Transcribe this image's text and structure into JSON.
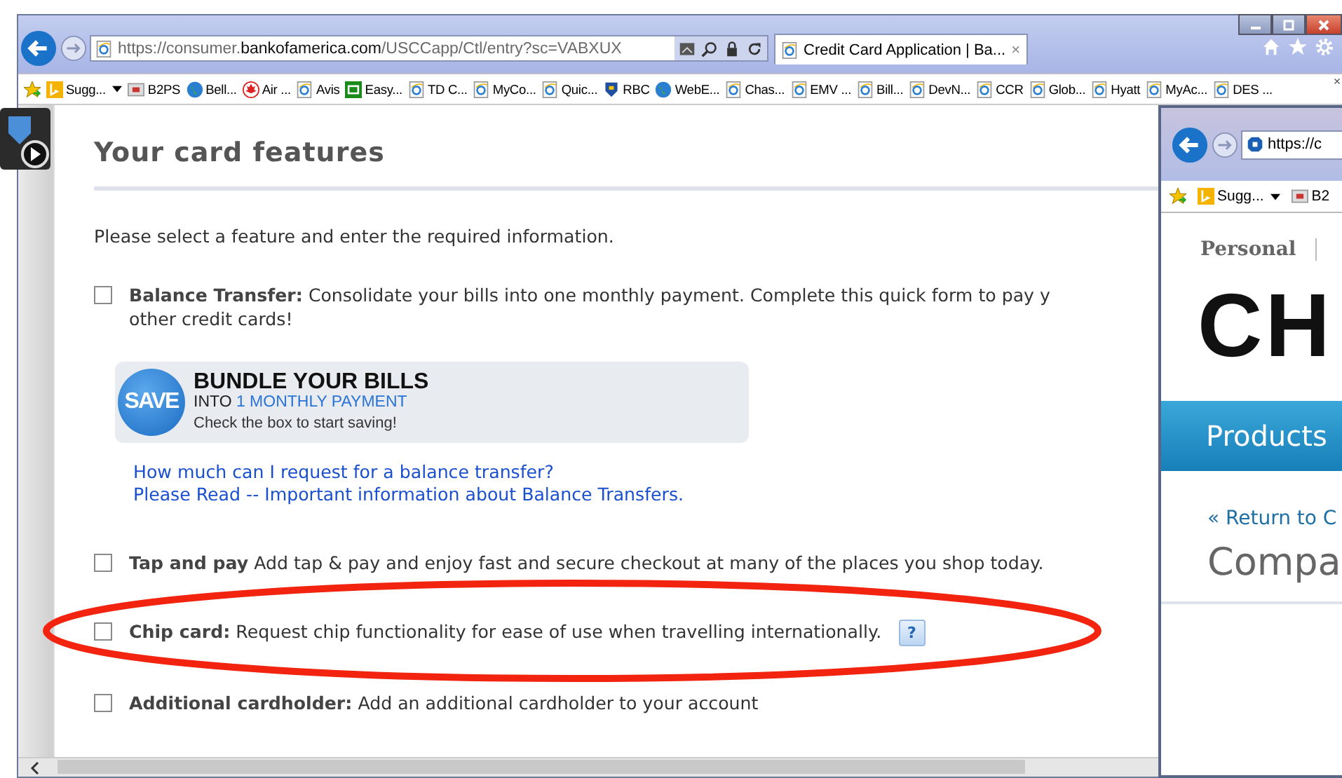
{
  "browser": {
    "address": "https://consumer.**bankofamerica.com**/USCCapp/Ctl/entry?sc=VABXUX",
    "tab": {
      "title": "Credit Card Application | Ba...",
      "close": "×"
    },
    "favorites": [
      {
        "label": "Sugg...",
        "kind": "bing",
        "dropdown": true
      },
      {
        "label": "B2PS",
        "kind": "b2",
        "dropdown": false
      },
      {
        "label": "Bell...",
        "kind": "globe",
        "dropdown": false
      },
      {
        "label": "Air ...",
        "kind": "leaf",
        "dropdown": false
      },
      {
        "label": "Avis",
        "kind": "page",
        "dropdown": false
      },
      {
        "label": "Easy...",
        "kind": "td",
        "dropdown": false
      },
      {
        "label": "TD C...",
        "kind": "page",
        "dropdown": false
      },
      {
        "label": "MyCo...",
        "kind": "page",
        "dropdown": false
      },
      {
        "label": "Quic...",
        "kind": "page",
        "dropdown": false
      },
      {
        "label": "RBC",
        "kind": "bank",
        "dropdown": false
      },
      {
        "label": "WebE...",
        "kind": "globe",
        "dropdown": false
      },
      {
        "label": "Chas...",
        "kind": "page",
        "dropdown": false
      },
      {
        "label": "EMV ...",
        "kind": "page",
        "dropdown": false
      },
      {
        "label": "Bill...",
        "kind": "page",
        "dropdown": false
      },
      {
        "label": "DevN...",
        "kind": "page",
        "dropdown": false
      },
      {
        "label": "CCR",
        "kind": "page",
        "dropdown": false
      },
      {
        "label": "Glob...",
        "kind": "page",
        "dropdown": false
      },
      {
        "label": "Hyatt",
        "kind": "page",
        "dropdown": false
      },
      {
        "label": "MyAc...",
        "kind": "page",
        "dropdown": false
      },
      {
        "label": "DES ...",
        "kind": "page",
        "dropdown": false
      }
    ],
    "favorites_close": "×"
  },
  "page": {
    "heading": "Your card features",
    "intro": "Please select a feature and enter the required information.",
    "features": [
      {
        "title": "Balance Transfer:",
        "lines": [
          "Consolidate your bills into one monthly payment. Complete this quick form to pay y",
          "other credit cards!"
        ],
        "checked": false,
        "promo": {
          "badge": "SAVE",
          "headline": "BUNDLE YOUR BILLS",
          "into": "INTO",
          "highlight": "1 MONTHLY PAYMENT",
          "note": "Check the box to start saving!"
        },
        "links": [
          "How much can I request for a balance transfer?",
          "Please Read -- Important information about Balance Transfers."
        ]
      },
      {
        "title": "Tap and pay",
        "lines": [
          "Add tap & pay and enjoy fast and secure checkout at many of the places you shop today."
        ],
        "checked": false
      },
      {
        "title": "Chip card:",
        "lines": [
          "Request chip functionality for ease of use when travelling internationally."
        ],
        "checked": false,
        "help": "?"
      },
      {
        "title": "Additional cardholder:",
        "lines": [
          "Add an additional cardholder to your account"
        ],
        "checked": false
      }
    ]
  },
  "second_window": {
    "address": "https://c",
    "favorites": [
      {
        "label": "Sugg...",
        "kind": "bing",
        "dropdown": true
      },
      {
        "label": "B2",
        "kind": "b2",
        "dropdown": false
      }
    ],
    "nav": "Personal",
    "logo": "CH",
    "menu": "Products",
    "return_link": "« Return to C",
    "heading": "Compa"
  }
}
